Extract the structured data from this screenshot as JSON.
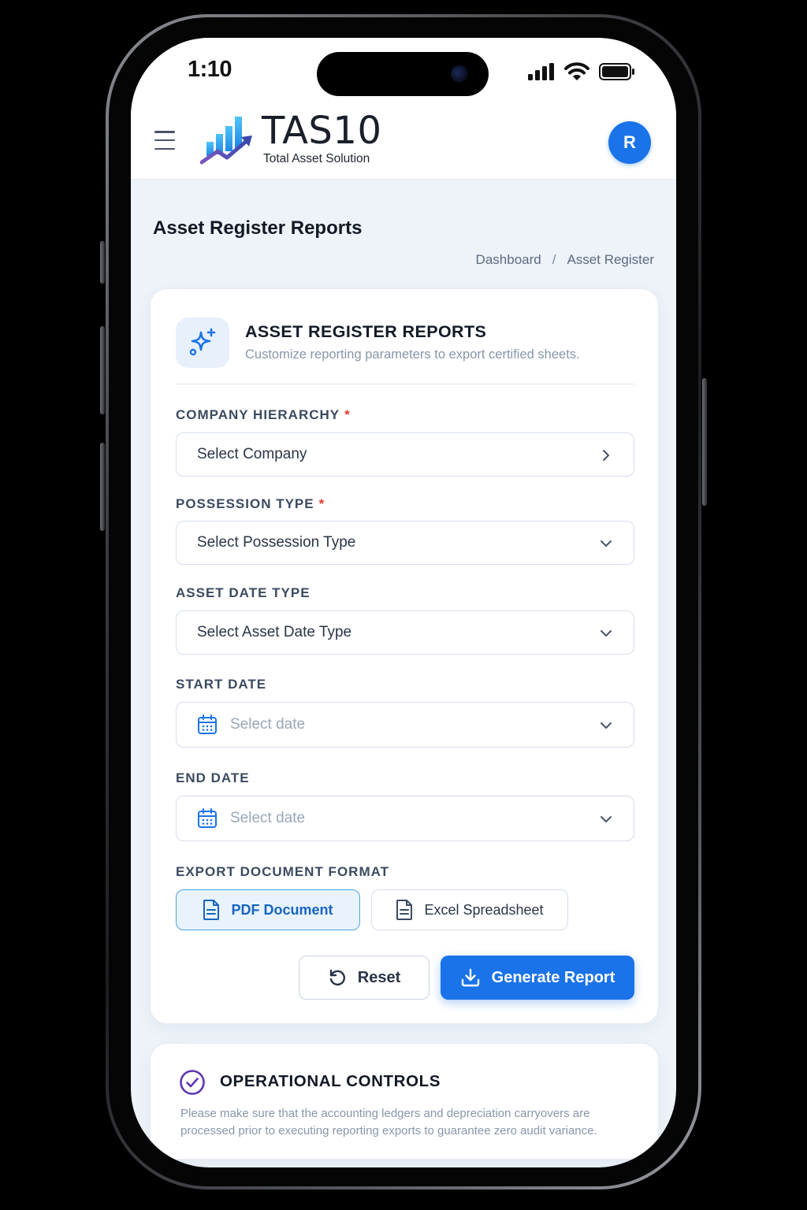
{
  "status_bar": {
    "time": "1:10"
  },
  "header": {
    "app_name": "TAS10",
    "app_tagline": "Total Asset Solution",
    "avatar_initial": "R",
    "brand_color": "#1a73e8"
  },
  "page": {
    "title": "Asset Register Reports",
    "breadcrumb": [
      "Dashboard",
      "/",
      "Asset Register"
    ]
  },
  "report_card": {
    "title": "ASSET REGISTER REPORTS",
    "subtitle": "Customize reporting parameters to export certified sheets.",
    "icon": "sparkles-icon",
    "fields": {
      "company": {
        "label": "COMPANY HIERARCHY",
        "required_mark": "*",
        "value": "Select Company",
        "icon": "chevron-right-icon"
      },
      "possession_type": {
        "label": "POSSESSION TYPE",
        "required_mark": "*",
        "value": "Select Possession Type",
        "icon": "chevron-down-icon"
      },
      "asset_date_type": {
        "label": "ASSET DATE TYPE",
        "value": "Select Asset Date Type",
        "icon": "chevron-down-icon"
      },
      "start_date": {
        "label": "START DATE",
        "placeholder": "Select date",
        "icon": "calendar-icon"
      },
      "end_date": {
        "label": "END DATE",
        "placeholder": "Select date",
        "icon": "calendar-icon"
      }
    },
    "export_format": {
      "label": "EXPORT DOCUMENT FORMAT",
      "options": [
        "PDF Document",
        "Excel Spreadsheet"
      ],
      "selected": "PDF Document"
    },
    "actions": {
      "reset_label": "Reset",
      "generate_label": "Generate Report"
    }
  },
  "operational_controls": {
    "title": "OPERATIONAL CONTROLS",
    "text": "Please make sure that the accounting ledgers and depreciation carryovers are processed prior to executing reporting exports to guarantee zero audit variance.",
    "icon": "check-circle-icon"
  }
}
